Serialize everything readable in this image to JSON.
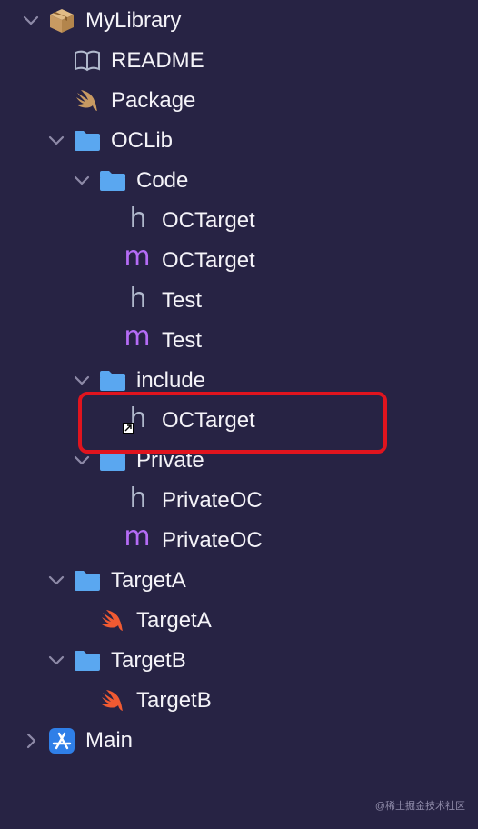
{
  "colors": {
    "background": "#272344",
    "text": "#f4f3f8",
    "chevron": "#8e8aa8",
    "folder": "#5aa7f0",
    "header_h": "#b0b8cc",
    "impl_m": "#b56cf6",
    "swift_orange": "#f05a32",
    "package_tan": "#c89a62",
    "highlight_red": "#e0141e",
    "app_blue": "#2f7fe8"
  },
  "tree": {
    "items": [
      {
        "label": "MyLibrary",
        "icon": "package-box-icon",
        "expanded": true
      },
      {
        "label": "README",
        "icon": "book-icon"
      },
      {
        "label": "Package",
        "icon": "swift-package-icon"
      },
      {
        "label": "OCLib",
        "icon": "folder-icon",
        "expanded": true
      },
      {
        "label": "Code",
        "icon": "folder-icon",
        "expanded": true
      },
      {
        "label": "OCTarget",
        "icon": "header-h-icon"
      },
      {
        "label": "OCTarget",
        "icon": "implementation-m-icon"
      },
      {
        "label": "Test",
        "icon": "header-h-icon"
      },
      {
        "label": "Test",
        "icon": "implementation-m-icon"
      },
      {
        "label": "include",
        "icon": "folder-icon",
        "expanded": true
      },
      {
        "label": "OCTarget",
        "icon": "header-h-icon",
        "highlighted": true
      },
      {
        "label": "Private",
        "icon": "folder-icon",
        "expanded": true
      },
      {
        "label": "PrivateOC",
        "icon": "header-h-icon"
      },
      {
        "label": "PrivateOC",
        "icon": "implementation-m-icon"
      },
      {
        "label": "TargetA",
        "icon": "folder-icon",
        "expanded": true
      },
      {
        "label": "TargetA",
        "icon": "swift-icon"
      },
      {
        "label": "TargetB",
        "icon": "folder-icon",
        "expanded": true
      },
      {
        "label": "TargetB",
        "icon": "swift-icon"
      },
      {
        "label": "Main",
        "icon": "app-store-icon",
        "expanded": false
      }
    ]
  },
  "glyphs": {
    "h": "h",
    "m": "m"
  },
  "watermark": "@稀土掘金技术社区"
}
